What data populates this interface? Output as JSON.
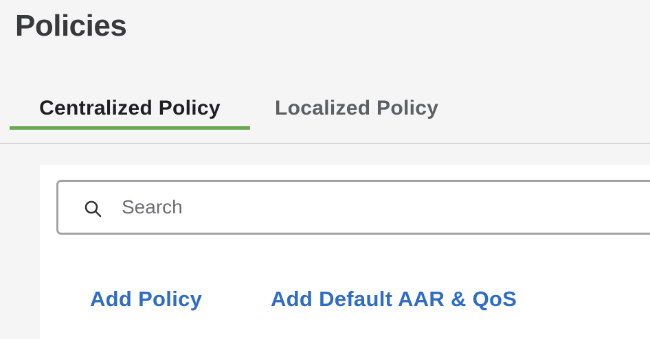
{
  "page": {
    "title": "Policies"
  },
  "tabs": [
    {
      "label": "Centralized Policy",
      "active": true
    },
    {
      "label": "Localized Policy",
      "active": false
    }
  ],
  "search": {
    "placeholder": "Search",
    "value": "",
    "icon": "search-icon"
  },
  "actions": {
    "add_policy": "Add Policy",
    "add_default": "Add Default AAR & QoS"
  },
  "colors": {
    "accent_underline": "#6aa84f",
    "link": "#2e6cc7",
    "background": "#f5f5f5",
    "panel": "#ffffff"
  }
}
